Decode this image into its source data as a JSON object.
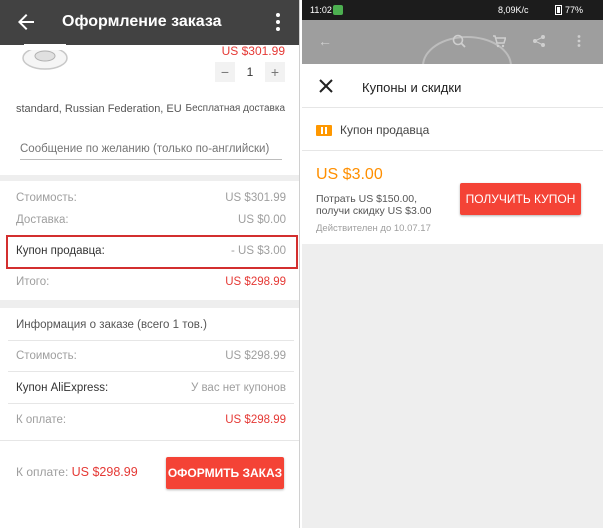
{
  "left": {
    "appbar": {
      "title": "Оформление заказа"
    },
    "product": {
      "price": "US $301.99",
      "quantity": "1",
      "minus": "−",
      "plus": "+",
      "variant": "standard, Russian Federation, EU",
      "shipping": "Бесплатная доставка"
    },
    "message_placeholder": "Сообщение по желанию (только по-английски)",
    "summary": {
      "cost_label": "Стоимость:",
      "cost_value": "US $301.99",
      "delivery_label": "Доставка:",
      "delivery_value": "US $0.00",
      "coupon_label": "Купон продавца:",
      "coupon_value": "- US $3.00",
      "total_label": "Итого:",
      "total_value": "US $298.99"
    },
    "info": {
      "title": "Информация о заказе (всего 1 тов.)",
      "cost_label": "Стоимость:",
      "cost_value": "US $298.99",
      "ali_coupon_label": "Купон AliExpress:",
      "ali_coupon_value": "У вас нет купонов",
      "pay_label": "К оплате:",
      "pay_value": "US $298.99"
    },
    "bottom": {
      "pay_label": "К оплате:",
      "pay_value": "US $298.99",
      "order_button": "ОФОРМИТЬ ЗАКАЗ"
    }
  },
  "right": {
    "statusbar": {
      "time": "11:02",
      "speed": "8,09K/c",
      "battery": "77%"
    },
    "sheet": {
      "title": "Купоны и скидки",
      "seller_coupon_label": "Купон продавца",
      "amount": "US $3.00",
      "condition_line1": "Потрать US $150.00,",
      "condition_line2": "получи скидку US $3.00",
      "valid": "Действителен до 10.07.17",
      "get_button": "ПОЛУЧИТЬ КУПОН"
    }
  },
  "colors": {
    "accent_red": "#f44336",
    "price_red": "#e53935",
    "coupon_orange": "#ff8f00",
    "appbar": "#424242"
  }
}
